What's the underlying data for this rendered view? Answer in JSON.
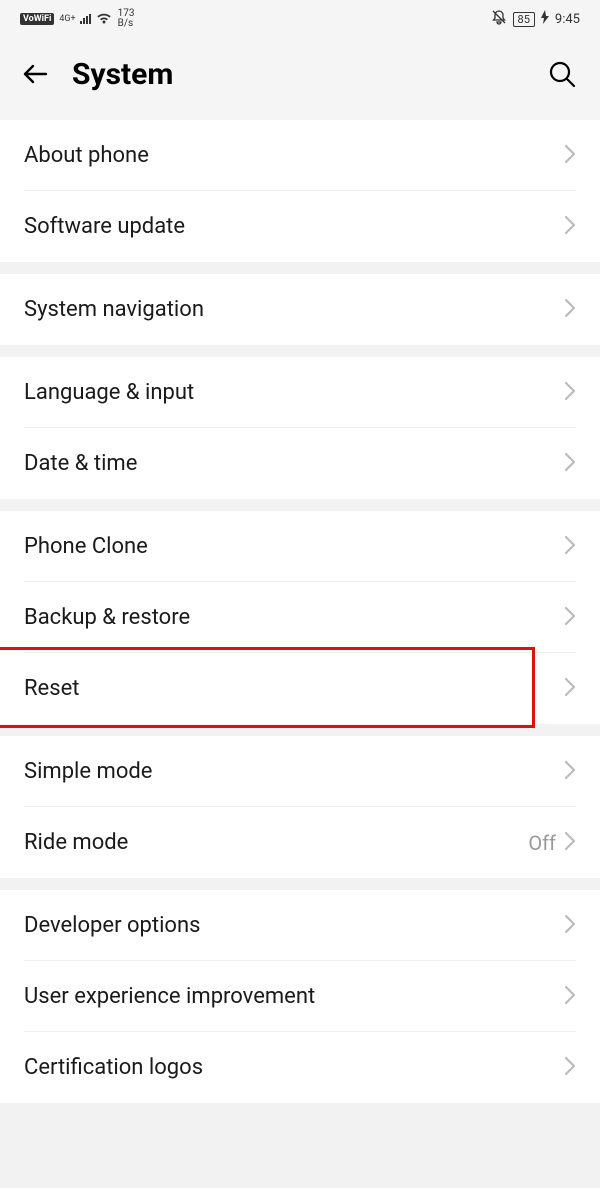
{
  "status": {
    "vowifi": "VoWiFi",
    "net": "4G+",
    "speed_value": "173",
    "speed_unit": "B/s",
    "battery": "85",
    "time": "9:45"
  },
  "header": {
    "title": "System"
  },
  "groups": [
    {
      "rows": [
        {
          "key": "about-phone",
          "label": "About phone"
        },
        {
          "key": "software-update",
          "label": "Software update"
        }
      ]
    },
    {
      "rows": [
        {
          "key": "system-navigation",
          "label": "System navigation"
        }
      ]
    },
    {
      "rows": [
        {
          "key": "language-input",
          "label": "Language & input"
        },
        {
          "key": "date-time",
          "label": "Date & time"
        }
      ]
    },
    {
      "rows": [
        {
          "key": "phone-clone",
          "label": "Phone Clone"
        },
        {
          "key": "backup-restore",
          "label": "Backup & restore"
        },
        {
          "key": "reset",
          "label": "Reset",
          "highlighted": true
        }
      ]
    },
    {
      "rows": [
        {
          "key": "simple-mode",
          "label": "Simple mode"
        },
        {
          "key": "ride-mode",
          "label": "Ride mode",
          "value": "Off"
        }
      ]
    },
    {
      "rows": [
        {
          "key": "developer-options",
          "label": "Developer options"
        },
        {
          "key": "user-experience-improvement",
          "label": "User experience improvement"
        },
        {
          "key": "certification-logos",
          "label": "Certification logos"
        }
      ]
    }
  ]
}
